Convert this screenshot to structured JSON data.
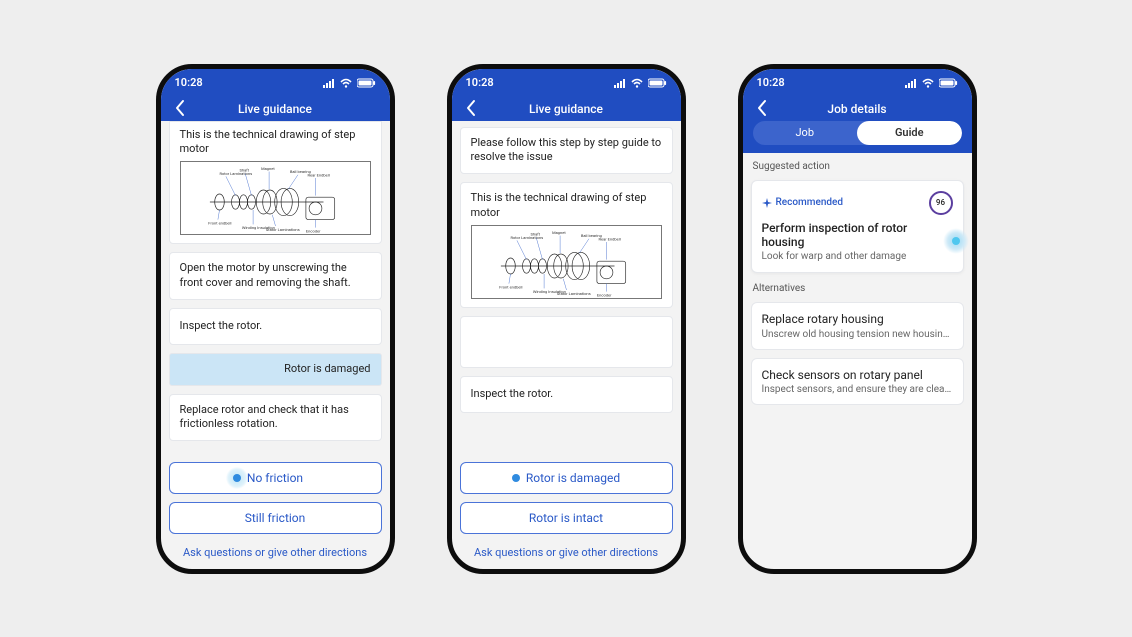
{
  "status": {
    "time": "10:28"
  },
  "screens": {
    "s1": {
      "title": "Live guidance",
      "intro_drawing": "This is the technical drawing of step motor",
      "step_open": "Open the motor by unscrewing the front cover and removing the shaft.",
      "step_inspect": "Inspect the rotor.",
      "user_reply": "Rotor is damaged",
      "step_replace": "Replace rotor and check that it has frictionless rotation.",
      "btn_a": "No friction",
      "btn_b": "Still friction",
      "ask": "Ask questions or give other directions"
    },
    "s2": {
      "title": "Live guidance",
      "intro_follow": "Please follow this step by step guide to resolve the issue",
      "intro_drawing": "This is the technical drawing of step motor",
      "step_inspect": "Inspect the rotor.",
      "btn_a": "Rotor is damaged",
      "btn_b": "Rotor is intact",
      "ask": "Ask questions or give other directions"
    },
    "s3": {
      "title": "Job details",
      "tab_job": "Job",
      "tab_guide": "Guide",
      "section_suggested": "Suggested action",
      "rec_badge": "Recommended",
      "rec_score": "96",
      "rec_title": "Perform inspection of rotor housing",
      "rec_sub": "Look for warp and other damage",
      "section_alt": "Alternatives",
      "alt1_title": "Replace rotary housing",
      "alt1_sub": "Unscrew old housing tension new housing tor...",
      "alt2_title": "Check sensors on rotary panel",
      "alt2_sub": "Inspect sensors, and ensure they are cleaned o..."
    }
  }
}
